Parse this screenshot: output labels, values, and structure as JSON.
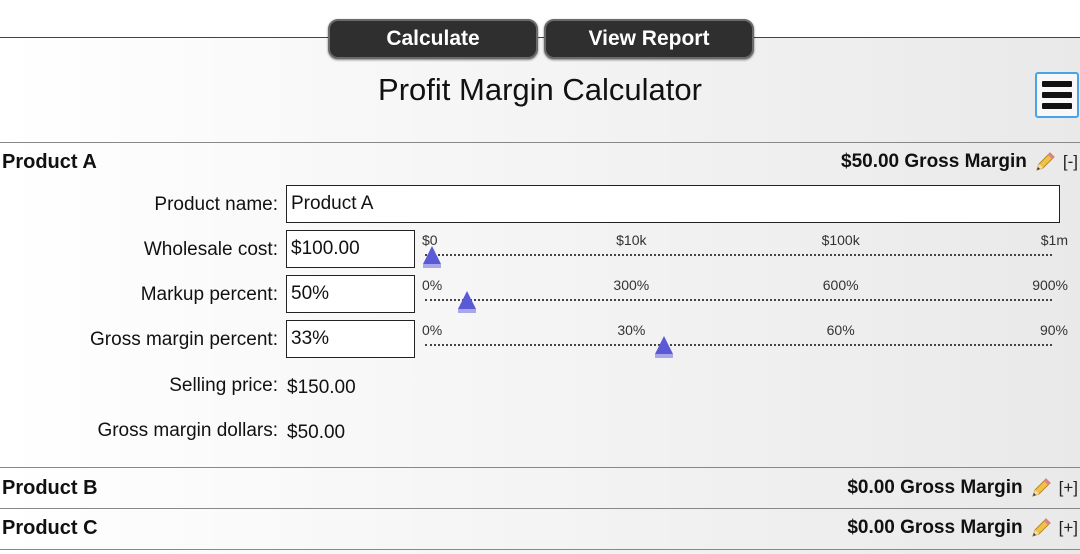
{
  "toolbar": {
    "calculate_label": "Calculate",
    "report_label": "View Report"
  },
  "page": {
    "title": "Profit Margin Calculator",
    "menu_icon": "hamburger-menu-icon"
  },
  "products": [
    {
      "title": "Product A",
      "summary": "$50.00 Gross Margin",
      "toggle": "[-]",
      "expanded": true
    },
    {
      "title": "Product B",
      "summary": "$0.00 Gross Margin",
      "toggle": "[+]",
      "expanded": false
    },
    {
      "title": "Product C",
      "summary": "$0.00 Gross Margin",
      "toggle": "[+]",
      "expanded": false
    }
  ],
  "form": {
    "product_name_label": "Product name:",
    "product_name_value": "Product A",
    "wholesale_label": "Wholesale cost:",
    "wholesale_value": "$100.00",
    "markup_label": "Markup percent:",
    "markup_value": "50%",
    "margin_label": "Gross margin percent:",
    "margin_value": "33%",
    "selling_label": "Selling price:",
    "selling_value": "$150.00",
    "margin_dollars_label": "Gross margin dollars:",
    "margin_dollars_value": "$50.00"
  },
  "sliders": {
    "wholesale": {
      "ticks": [
        "$0",
        "$10k",
        "$100k",
        "$1m"
      ],
      "position": 0.0
    },
    "markup": {
      "ticks": [
        "0%",
        "300%",
        "600%",
        "900%"
      ],
      "position": 0.056
    },
    "margin": {
      "ticks": [
        "0%",
        "30%",
        "60%",
        "90%"
      ],
      "position": 0.37
    }
  },
  "colors": {
    "button_bg": "#2f2f2f",
    "slider_thumb": "#5a5ad6",
    "menu_border": "#4aa3e6"
  }
}
